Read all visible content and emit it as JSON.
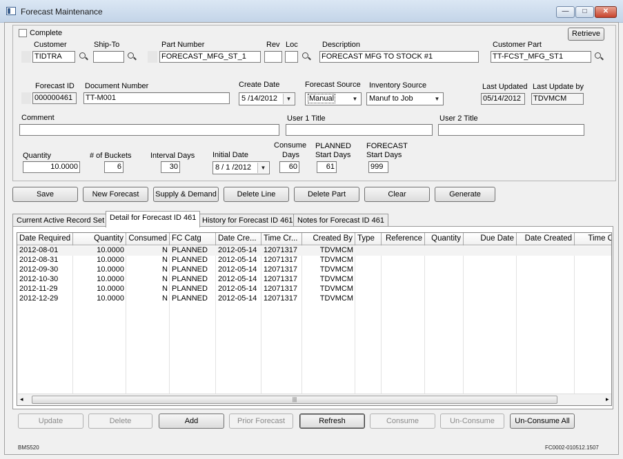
{
  "window": {
    "title": "Forecast Maintenance",
    "min_glyph": "—",
    "max_glyph": "□",
    "close_glyph": "✕"
  },
  "header": {
    "complete_label": "Complete",
    "retrieve_label": "Retrieve",
    "customer": {
      "label": "Customer",
      "value": "TIDTRA"
    },
    "ship_to": {
      "label": "Ship-To",
      "value": ""
    },
    "part_number": {
      "label": "Part Number",
      "value": "FORECAST_MFG_ST_1"
    },
    "rev": {
      "label": "Rev",
      "value": ""
    },
    "loc": {
      "label": "Loc",
      "value": ""
    },
    "description": {
      "label": "Description",
      "value": "FORECAST MFG TO STOCK #1"
    },
    "customer_part": {
      "label": "Customer Part",
      "value": "TT-FCST_MFG_ST1"
    },
    "forecast_id": {
      "label": "Forecast ID",
      "value": "000000461"
    },
    "document_number": {
      "label": "Document Number",
      "value": "TT-M001"
    },
    "create_date": {
      "label": "Create Date",
      "value": "5 /14/2012"
    },
    "forecast_source": {
      "label": "Forecast Source",
      "value": "Manual"
    },
    "inventory_source": {
      "label": "Inventory Source",
      "value": "Manuf to Job"
    },
    "last_updated": {
      "label": "Last Updated",
      "value": "05/14/2012"
    },
    "last_update_by": {
      "label": "Last Update by",
      "value": "TDVMCM"
    },
    "comment": {
      "label": "Comment",
      "value": ""
    },
    "user1_title": {
      "label": "User 1 Title",
      "value": ""
    },
    "user2_title": {
      "label": "User 2 Title",
      "value": ""
    },
    "quantity": {
      "label": "Quantity",
      "value": "10.0000"
    },
    "buckets": {
      "label": "# of Buckets",
      "value": "6"
    },
    "interval_days": {
      "label": "Interval Days",
      "value": "30"
    },
    "initial_date": {
      "label": "Initial Date",
      "value": "8 / 1 /2012"
    },
    "consume_days": {
      "label1": "Consume",
      "label2": "Days",
      "value": "60"
    },
    "planned_start": {
      "label1": "PLANNED",
      "label2": "Start Days",
      "value": "61"
    },
    "forecast_start": {
      "label1": "FORECAST",
      "label2": "Start Days",
      "value": "999"
    }
  },
  "actions": [
    "Save",
    "New Forecast",
    "Supply & Demand",
    "Delete Line",
    "Delete Part",
    "Clear",
    "Generate"
  ],
  "tabs": [
    "Current Active Record Set",
    "Detail for Forecast ID 461",
    "History for Forecast ID 461",
    "Notes for Forecast ID 461"
  ],
  "grid": {
    "columns": [
      "Date Required",
      "Quantity",
      "Consumed",
      "FC Catg",
      "Date Cre...",
      "Time Cr...",
      "Created By",
      "Type",
      "Reference",
      "Quantity",
      "Due Date",
      "Date Created",
      "Time C"
    ],
    "rows": [
      [
        "2012-08-01",
        "10.0000",
        "N",
        "PLANNED",
        "2012-05-14",
        "12071317",
        "TDVMCM"
      ],
      [
        "2012-08-31",
        "10.0000",
        "N",
        "PLANNED",
        "2012-05-14",
        "12071317",
        "TDVMCM"
      ],
      [
        "2012-09-30",
        "10.0000",
        "N",
        "PLANNED",
        "2012-05-14",
        "12071317",
        "TDVMCM"
      ],
      [
        "2012-10-30",
        "10.0000",
        "N",
        "PLANNED",
        "2012-05-14",
        "12071317",
        "TDVMCM"
      ],
      [
        "2012-11-29",
        "10.0000",
        "N",
        "PLANNED",
        "2012-05-14",
        "12071317",
        "TDVMCM"
      ],
      [
        "2012-12-29",
        "10.0000",
        "N",
        "PLANNED",
        "2012-05-14",
        "12071317",
        "TDVMCM"
      ]
    ],
    "scroll_left": "◂",
    "scroll_right": "▸",
    "scroll_grip": "|||"
  },
  "bottom_buttons": [
    "Update",
    "Delete",
    "Add",
    "Prior Forecast",
    "Refresh",
    "Consume",
    "Un-Consume",
    "Un-Consume All"
  ],
  "footer": {
    "left": "BMS520",
    "right": "FC0002-010512.1507"
  }
}
